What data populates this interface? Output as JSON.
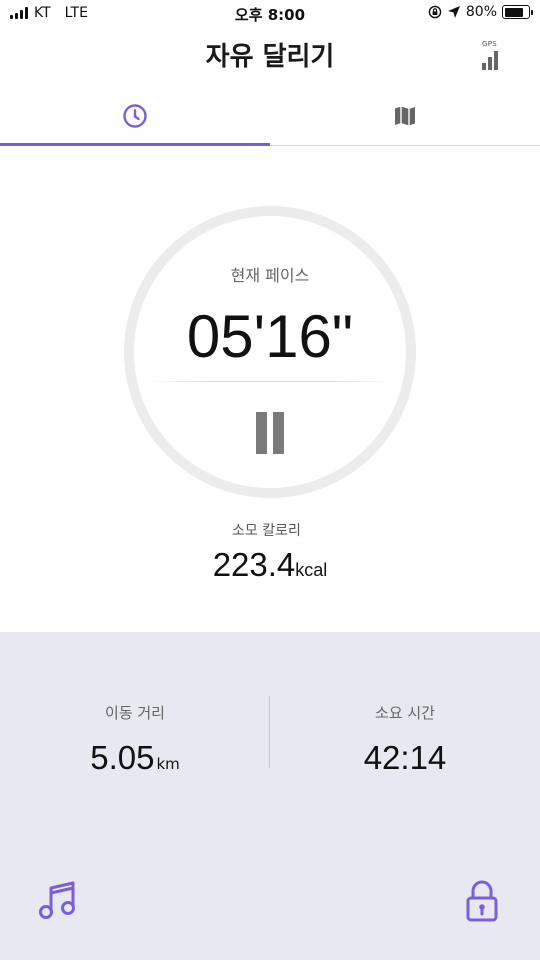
{
  "status_bar": {
    "carrier": "KT",
    "network": "LTE",
    "time": "오후 8:00",
    "battery": "80%",
    "battery_level": 0.8
  },
  "header": {
    "title": "자유 달리기",
    "gps_label": "GPS",
    "gps_icon": "gps-signal-icon"
  },
  "tabs": [
    {
      "icon": "clock-icon",
      "active": true
    },
    {
      "icon": "map-icon",
      "active": false
    }
  ],
  "pace": {
    "label": "현재 페이스",
    "value": "05'16\""
  },
  "controls": {
    "pause_icon": "pause-icon"
  },
  "calories": {
    "label": "소모 칼로리",
    "value": "223.4",
    "unit": "kcal"
  },
  "stats": {
    "distance": {
      "label": "이동 거리",
      "value": "5.05",
      "unit": "km"
    },
    "duration": {
      "label": "소요 시간",
      "value": "42:14"
    }
  },
  "bottom_actions": {
    "music_icon": "music-note-icon",
    "lock_icon": "lock-icon"
  },
  "colors": {
    "accent": "#7b5fd6",
    "panel_bg": "#e7e8f1",
    "ring": "#ececec"
  }
}
